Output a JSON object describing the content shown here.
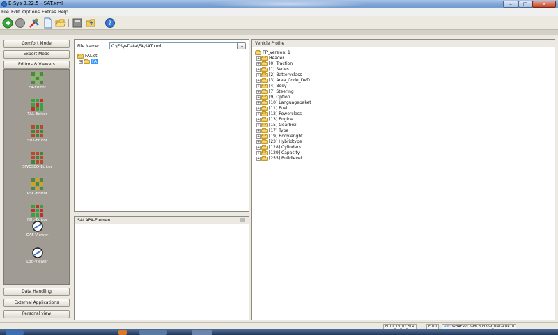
{
  "window": {
    "title": "E-Sys 3.22.5 - SAT.xml",
    "controls": {
      "minimize": "–",
      "maximize": "□",
      "close": "✕"
    }
  },
  "menu": {
    "items": [
      {
        "label": "File"
      },
      {
        "label": "Edit"
      },
      {
        "label": "Options"
      },
      {
        "label": "Extras"
      },
      {
        "label": "Help"
      }
    ]
  },
  "toolbar": {
    "buttons": [
      {
        "icon": "go-green-arrow-icon"
      },
      {
        "icon": "stop-gray-circle-icon"
      },
      {
        "icon": "tools-icon"
      },
      {
        "icon": "new-document-icon"
      },
      {
        "icon": "open-folder-icon"
      },
      {
        "icon": "save-icon"
      },
      {
        "icon": "open-folder-arrow-icon"
      },
      {
        "icon": "help-icon"
      }
    ]
  },
  "sidebar": {
    "top_buttons": [
      {
        "label": "Comfort Mode"
      },
      {
        "label": "Expert Mode"
      },
      {
        "label": "Editors & Viewers"
      }
    ],
    "editors": [
      {
        "label": "FA-Editor",
        "icon": "fa-editor-icon"
      },
      {
        "label": "TAL-Editor",
        "icon": "tal-editor-icon"
      },
      {
        "label": "SVT-Editor",
        "icon": "svt-editor-icon"
      },
      {
        "label": "SWESEQ-Editor",
        "icon": "sweseq-editor-icon"
      },
      {
        "label": "PSC-Editor",
        "icon": "psc-editor-icon"
      },
      {
        "label": "FDL-Editor",
        "icon": "fdl-editor-icon"
      },
      {
        "label": "CAF-Viewer",
        "icon": "caf-viewer-icon"
      },
      {
        "label": "Log-Viewer",
        "icon": "log-viewer-icon"
      }
    ],
    "bottom_buttons": [
      {
        "label": "Data Handling"
      },
      {
        "label": "External Applications"
      },
      {
        "label": "Personal view"
      }
    ]
  },
  "file_panel": {
    "file_name_label": "File Name:",
    "file_name_value": "C:\\ESysData\\FA\\SAT.xml",
    "browse_label": "...",
    "tree_root": "FAList",
    "tree_child": "FA"
  },
  "salapa_panel": {
    "title": "SALAPA-Element"
  },
  "vehicle_profile": {
    "title": "Vehicle Profile",
    "root": "FP_Version: 1",
    "items": [
      "Header",
      "[0] Traction",
      "[1] Series",
      "[2] Batteryclass",
      "[3] Area_Code_DVD",
      "[4] Body",
      "[7] Steering",
      "[9] Option",
      "[10] Languagepaket",
      "[11] Fuel",
      "[12] Powerclass",
      "[13] Engine",
      "[15] Gearbox",
      "[17] Type",
      "[19] Bodylenght",
      "[23] Hybridtype",
      "[128] Cylinders",
      "[129] Capacity",
      "[255] Buildlevel"
    ]
  },
  "status": {
    "cell1": "F010_13_07_504",
    "cell2": "F010",
    "vin_label": "VIN:",
    "vin_value": "WBAFR7C59BC803369_DIAGADR10"
  }
}
